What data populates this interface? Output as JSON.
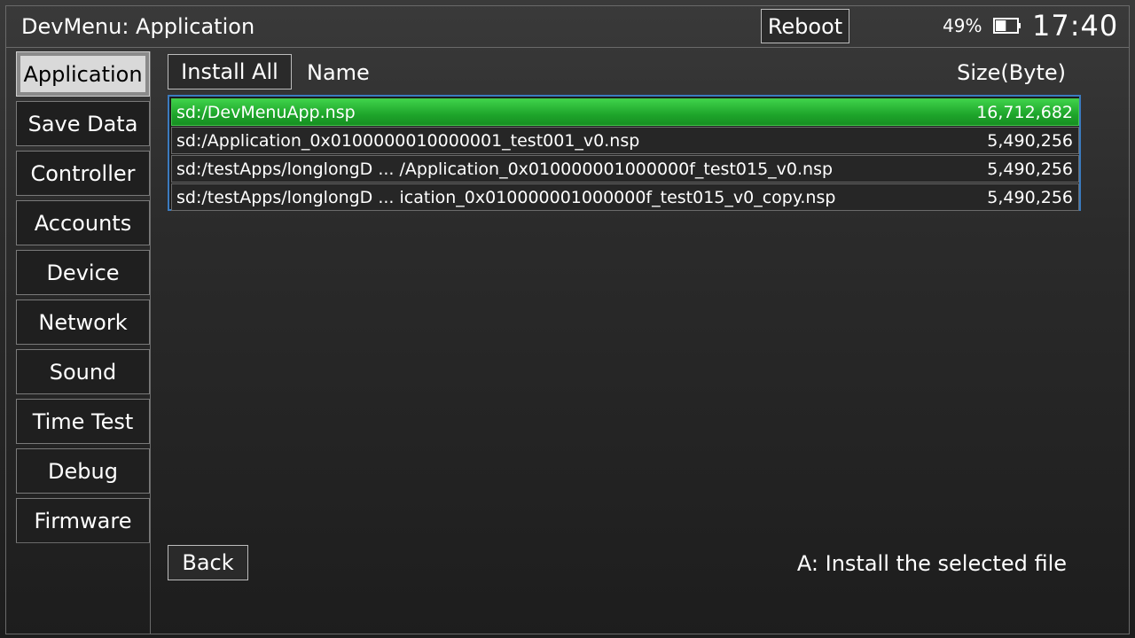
{
  "header": {
    "title": "DevMenu: Application",
    "reboot_label": "Reboot",
    "battery_percent": "49%",
    "battery_level": 0.49,
    "clock": "17:40"
  },
  "sidebar": {
    "items": [
      {
        "label": "Application",
        "active": true
      },
      {
        "label": "Save Data",
        "active": false
      },
      {
        "label": "Controller",
        "active": false
      },
      {
        "label": "Accounts",
        "active": false
      },
      {
        "label": "Device",
        "active": false
      },
      {
        "label": "Network",
        "active": false
      },
      {
        "label": "Sound",
        "active": false
      },
      {
        "label": "Time Test",
        "active": false
      },
      {
        "label": "Debug",
        "active": false
      },
      {
        "label": "Firmware",
        "active": false
      }
    ]
  },
  "main": {
    "install_all_label": "Install All",
    "columns": {
      "name": "Name",
      "size": "Size(Byte)"
    },
    "files": [
      {
        "name": "sd:/DevMenuApp.nsp",
        "size": "16,712,682",
        "selected": true
      },
      {
        "name": "sd:/Application_0x0100000010000001_test001_v0.nsp",
        "size": "5,490,256",
        "selected": false
      },
      {
        "name": "sd:/testApps/longlongD ... /Application_0x010000001000000f_test015_v0.nsp",
        "size": "5,490,256",
        "selected": false
      },
      {
        "name": "sd:/testApps/longlongD ... ication_0x010000001000000f_test015_v0_copy.nsp",
        "size": "5,490,256",
        "selected": false
      }
    ],
    "back_label": "Back",
    "hint": "A: Install the selected file"
  },
  "colors": {
    "selection_green": "#1ea52b",
    "list_border_blue": "#3b7bbf",
    "active_tab": "#d9d9d9"
  },
  "icons": {
    "battery": "battery-icon"
  }
}
